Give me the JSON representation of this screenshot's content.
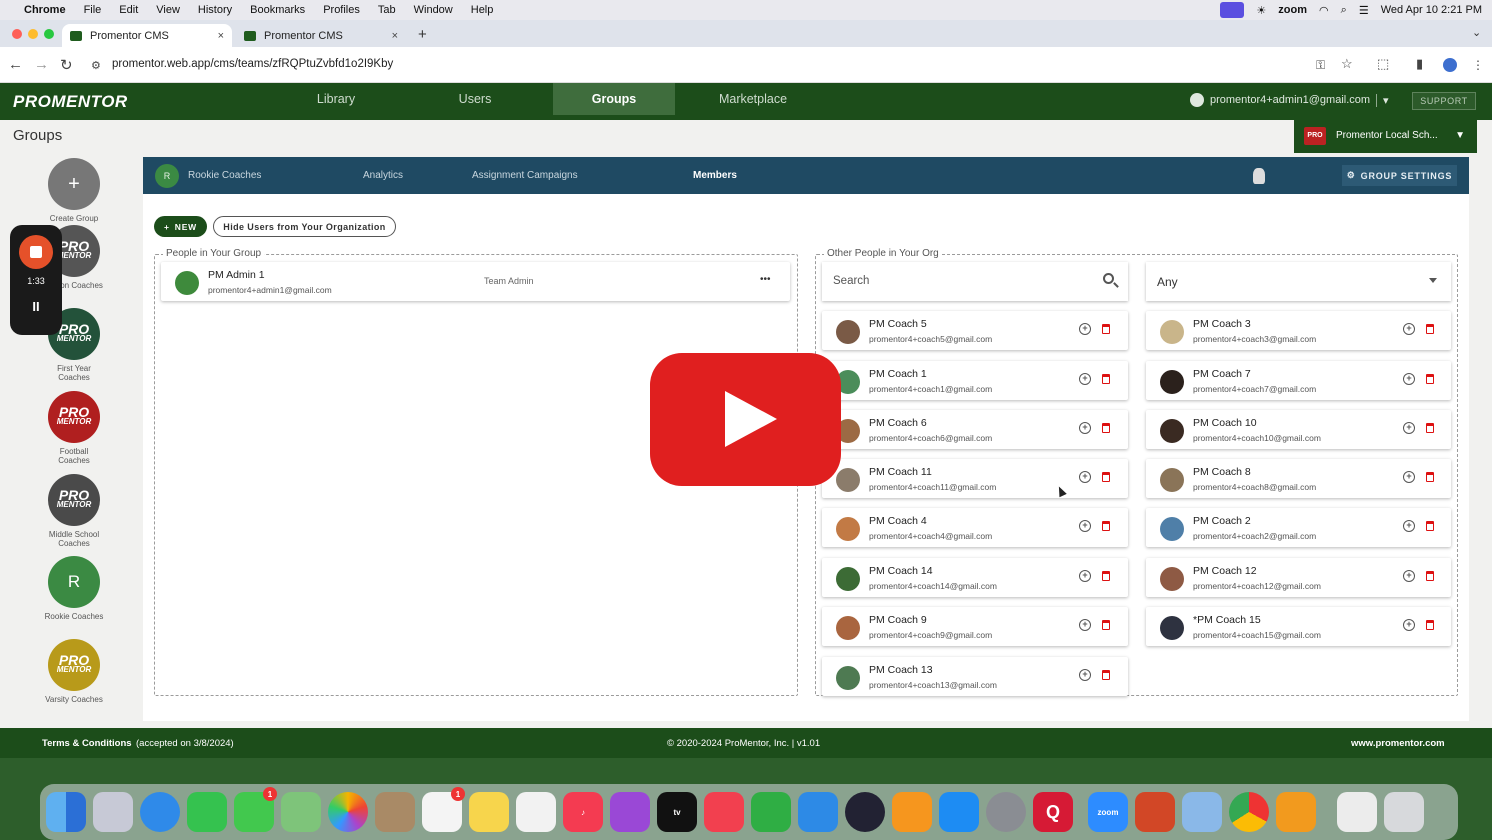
{
  "menubar": {
    "app": "Chrome",
    "items": [
      "File",
      "Edit",
      "View",
      "History",
      "Bookmarks",
      "Profiles",
      "Tab",
      "Window",
      "Help"
    ],
    "zoom": "zoom",
    "datetime": "Wed Apr 10  2:21 PM"
  },
  "tabs": [
    {
      "title": "Promentor CMS",
      "close": "×"
    },
    {
      "title": "Promentor CMS",
      "close": "×"
    }
  ],
  "new_tab": "+",
  "address": {
    "url": "promentor.web.app/cms/teams/zfRQPtuZvbfd1o2I9Kby"
  },
  "nav": {
    "logo": "PROMENTOR",
    "links": [
      "Library",
      "Users",
      "Groups",
      "Marketplace"
    ],
    "active": "Groups",
    "user_email": "promentor4+admin1@gmail.com",
    "support": "SUPPORT"
  },
  "page": {
    "title": "Groups",
    "org_select": "Promentor Local Sch...",
    "org_logo": "PRO"
  },
  "sidebar": {
    "create_label": "Create Group",
    "create_icon": "+",
    "groups": [
      {
        "label": "...ason Coaches",
        "logo": "PRO",
        "sub": "MENTOR",
        "color": "#555555"
      },
      {
        "label": "First Year Coaches",
        "logo": "PRO",
        "sub": "MENTOR",
        "color": "#23523a"
      },
      {
        "label": "Football Coaches",
        "logo": "PRO",
        "sub": "MENTOR",
        "color": "#b01f1f"
      },
      {
        "label": "Middle School Coaches",
        "logo": "PRO",
        "sub": "MENTOR",
        "color": "#4a4a4a"
      },
      {
        "label": "Rookie Coaches",
        "logo": "R",
        "sub": "",
        "color": "#3b8a43"
      },
      {
        "label": "Varsity Coaches",
        "logo": "PRO",
        "sub": "MENTOR",
        "color": "#b89a1a"
      }
    ]
  },
  "recorder": {
    "time": "1:33",
    "pause": "II"
  },
  "panel": {
    "group_initial": "R",
    "group_name": "Rookie Coaches",
    "tabs": [
      "Analytics",
      "Assignment Campaigns",
      "Members"
    ],
    "active_tab": "Members",
    "settings_label": "GROUP SETTINGS",
    "new_label": "NEW",
    "hide_label": "Hide Users from Your Organization"
  },
  "group_members": {
    "legend": "People in Your Group",
    "members": [
      {
        "name": "PM Admin 1",
        "email": "promentor4+admin1@gmail.com",
        "role": "Team Admin",
        "more": "•••"
      }
    ]
  },
  "org_people": {
    "legend": "Other People in Your Org",
    "search_placeholder": "Search",
    "filter_value": "Any",
    "left": [
      {
        "name": "PM Coach 5",
        "email": "promentor4+coach5@gmail.com"
      },
      {
        "name": "PM Coach 1",
        "email": "promentor4+coach1@gmail.com"
      },
      {
        "name": "PM Coach 6",
        "email": "promentor4+coach6@gmail.com"
      },
      {
        "name": "PM Coach 11",
        "email": "promentor4+coach11@gmail.com"
      },
      {
        "name": "PM Coach 4",
        "email": "promentor4+coach4@gmail.com"
      },
      {
        "name": "PM Coach 14",
        "email": "promentor4+coach14@gmail.com"
      },
      {
        "name": "PM Coach 9",
        "email": "promentor4+coach9@gmail.com"
      },
      {
        "name": "PM Coach 13",
        "email": "promentor4+coach13@gmail.com"
      }
    ],
    "right": [
      {
        "name": "PM Coach 3",
        "email": "promentor4+coach3@gmail.com"
      },
      {
        "name": "PM Coach 7",
        "email": "promentor4+coach7@gmail.com"
      },
      {
        "name": "PM Coach 10",
        "email": "promentor4+coach10@gmail.com"
      },
      {
        "name": "PM Coach 8",
        "email": "promentor4+coach8@gmail.com"
      },
      {
        "name": "PM Coach 2",
        "email": "promentor4+coach2@gmail.com"
      },
      {
        "name": "PM Coach 12",
        "email": "promentor4+coach12@gmail.com"
      },
      {
        "name": "*PM Coach 15",
        "email": "promentor4+coach15@gmail.com"
      }
    ],
    "add_icon": "+"
  },
  "footer": {
    "terms": "Terms & Conditions",
    "accepted": "(accepted on 3/8/2024)",
    "copyright": "© 2020-2024 ProMentor, Inc. | v1.01",
    "site": "www.promentor.com"
  },
  "dock": {
    "zoom_label": "zoom",
    "q_label": "Q",
    "tv_label": "tv",
    "messages_badge": "1",
    "reminders_badge": "1"
  }
}
